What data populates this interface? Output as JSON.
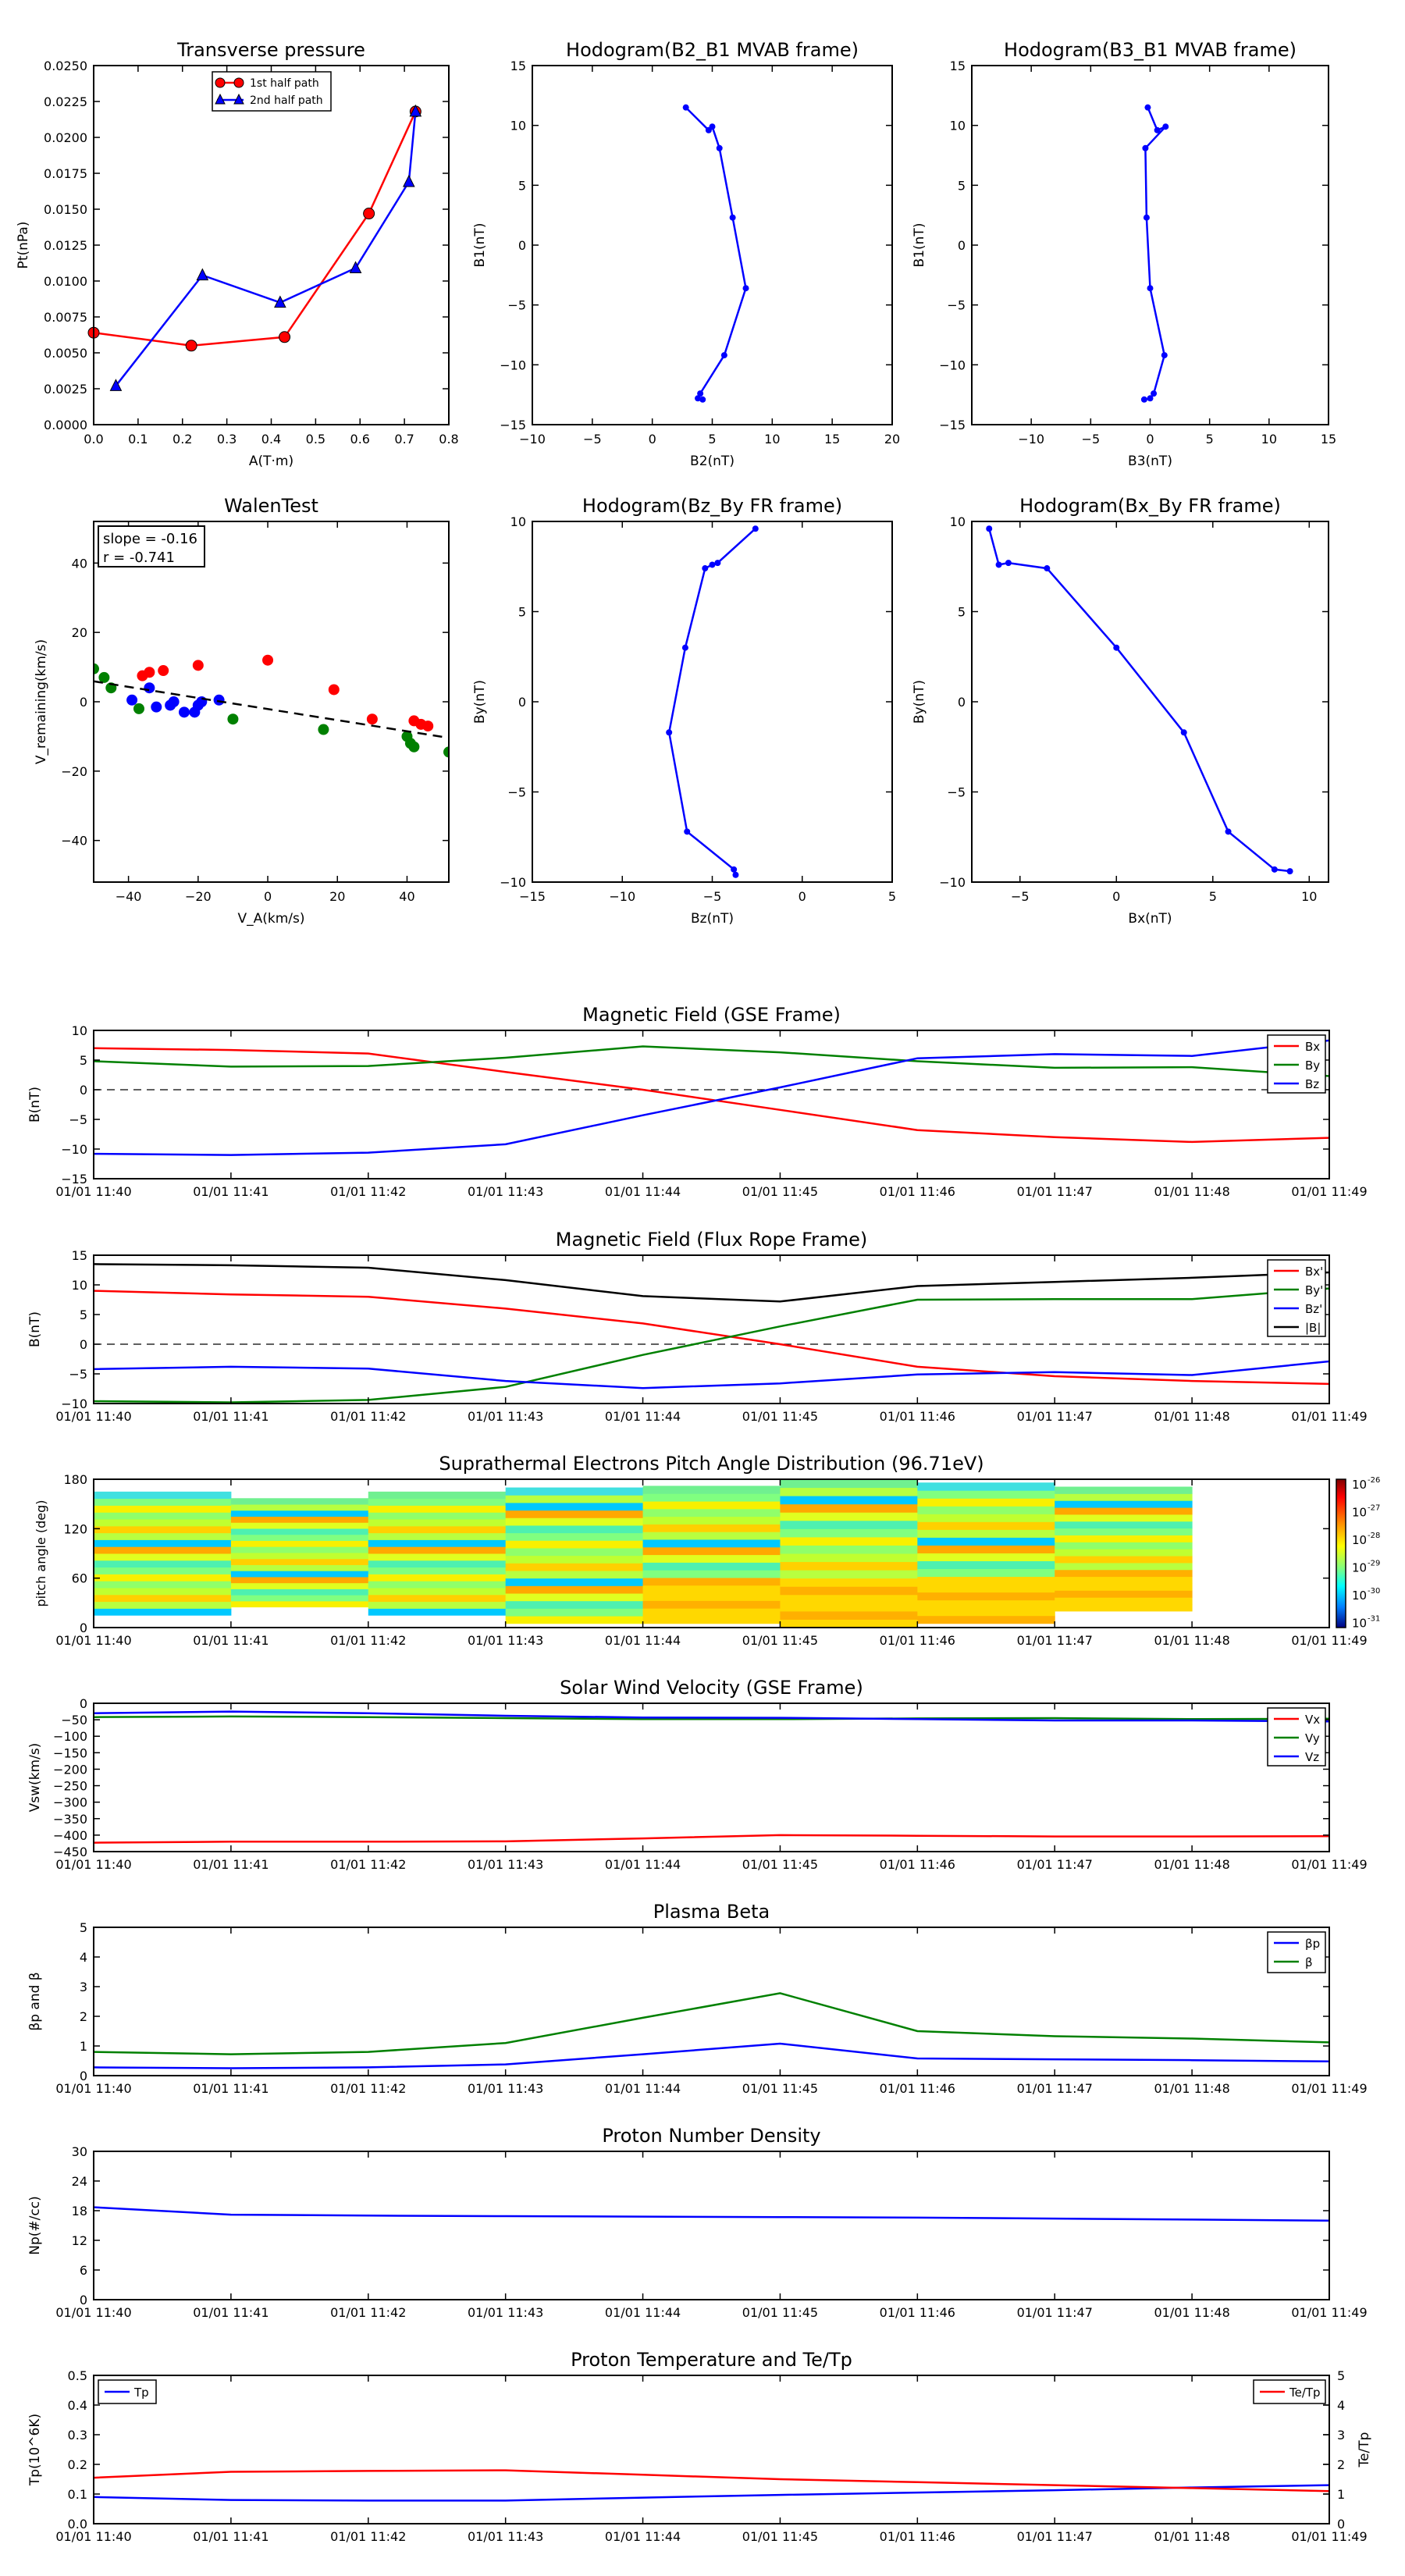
{
  "chart_data": [
    {
      "id": "tp",
      "type": "line",
      "title": "Transverse pressure",
      "xlabel": "A(T·m)",
      "ylabel": "Pt(nPa)",
      "xlim": [
        0.0,
        0.8
      ],
      "ylim": [
        0.0,
        0.025
      ],
      "xticks": [
        "0.0",
        "0.1",
        "0.2",
        "0.3",
        "0.4",
        "0.5",
        "0.6",
        "0.7",
        "0.8"
      ],
      "yticks": [
        "0.0000",
        "0.0025",
        "0.0050",
        "0.0075",
        "0.0100",
        "0.0125",
        "0.0150",
        "0.0175",
        "0.0200",
        "0.0225",
        "0.0250"
      ],
      "legend": "top-center",
      "series": [
        {
          "name": "1st half path",
          "color": "#ff0000",
          "marker": "circle",
          "x": [
            0.0,
            0.22,
            0.43,
            0.62,
            0.725
          ],
          "y": [
            0.0064,
            0.0055,
            0.0061,
            0.0147,
            0.0218
          ]
        },
        {
          "name": "2nd half path",
          "color": "#0000ff",
          "marker": "triangle",
          "x": [
            0.05,
            0.245,
            0.42,
            0.59,
            0.71,
            0.725
          ],
          "y": [
            0.0027,
            0.0104,
            0.0085,
            0.0109,
            0.0169,
            0.0218
          ]
        }
      ]
    },
    {
      "id": "h21",
      "type": "line",
      "title": "Hodogram(B2_B1 MVAB frame)",
      "xlabel": "B2(nT)",
      "ylabel": "B1(nT)",
      "xlim": [
        -10,
        20
      ],
      "ylim": [
        -15,
        15
      ],
      "xticks": [
        "−10",
        "−5",
        "0",
        "5",
        "10",
        "15",
        "20"
      ],
      "yticks": [
        "−15",
        "−10",
        "−5",
        "0",
        "5",
        "10",
        "15"
      ],
      "series": [
        {
          "color": "#0000ff",
          "marker": "dot",
          "x": [
            2.8,
            4.7,
            5.0,
            5.6,
            6.7,
            7.8,
            6.0,
            4.0,
            3.8,
            4.2
          ],
          "y": [
            11.5,
            9.6,
            9.9,
            8.1,
            2.3,
            -3.6,
            -9.2,
            -12.4,
            -12.8,
            -12.9
          ]
        }
      ]
    },
    {
      "id": "h31",
      "type": "line",
      "title": "Hodogram(B3_B1 MVAB frame)",
      "xlabel": "B3(nT)",
      "ylabel": "B1(nT)",
      "xlim": [
        -15,
        15
      ],
      "ylim": [
        -15,
        15
      ],
      "xticks": [
        "−10",
        "−5",
        "0",
        "5",
        "10",
        "15"
      ],
      "yticks": [
        "−15",
        "−10",
        "−5",
        "0",
        "5",
        "10",
        "15"
      ],
      "series": [
        {
          "color": "#0000ff",
          "marker": "dot",
          "x": [
            -0.2,
            0.6,
            1.3,
            -0.4,
            -0.3,
            0.0,
            1.2,
            0.3,
            0.0,
            -0.5
          ],
          "y": [
            11.5,
            9.6,
            9.9,
            8.1,
            2.3,
            -3.6,
            -9.2,
            -12.4,
            -12.8,
            -12.9
          ]
        }
      ]
    },
    {
      "id": "walen",
      "type": "scatter",
      "title": "WalenTest",
      "xlabel": "V_A(km/s)",
      "ylabel": "V_remaining(km/s)",
      "xlim": [
        -50,
        52
      ],
      "ylim": [
        -52,
        52
      ],
      "xticks": [
        "−40",
        "−20",
        "0",
        "20",
        "40"
      ],
      "yticks": [
        "−40",
        "−20",
        "0",
        "20",
        "40"
      ],
      "annotation": [
        "slope = -0.16",
        "r = -0.741"
      ],
      "fit": {
        "slope": -0.16,
        "intercept": -2.1
      },
      "series": [
        {
          "color": "#ff0000",
          "x": [
            -36,
            -34,
            -30,
            -20,
            0,
            19,
            30,
            42,
            44,
            46
          ],
          "y": [
            7.5,
            8.5,
            9,
            10.5,
            12,
            3.5,
            -5,
            -5.5,
            -6.5,
            -7
          ]
        },
        {
          "color": "#008000",
          "x": [
            -50,
            -47,
            -45,
            -37,
            -10,
            16,
            40,
            41,
            42,
            52
          ],
          "y": [
            9.5,
            7,
            4,
            -2,
            -5,
            -8,
            -10,
            -12,
            -13,
            -14.5
          ]
        },
        {
          "color": "#0000ff",
          "x": [
            -39,
            -34,
            -32,
            -28,
            -27,
            -24,
            -21,
            -20,
            -19,
            -14
          ],
          "y": [
            0.5,
            4,
            -1.5,
            -1,
            0,
            -3,
            -3,
            -1,
            0,
            0.5
          ]
        }
      ]
    },
    {
      "id": "hzy",
      "type": "line",
      "title": "Hodogram(Bz_By FR frame)",
      "xlabel": "Bz(nT)",
      "ylabel": "By(nT)",
      "xlim": [
        -15,
        5
      ],
      "ylim": [
        -10,
        10
      ],
      "xticks": [
        "−15",
        "−10",
        "−5",
        "0",
        "5"
      ],
      "yticks": [
        "−10",
        "−5",
        "0",
        "5",
        "10"
      ],
      "series": [
        {
          "color": "#0000ff",
          "marker": "dot",
          "x": [
            -2.6,
            -4.7,
            -5.0,
            -5.4,
            -6.5,
            -7.4,
            -6.4,
            -3.8,
            -3.7
          ],
          "y": [
            9.6,
            7.7,
            7.6,
            7.4,
            3.0,
            -1.7,
            -7.2,
            -9.3,
            -9.6
          ]
        }
      ]
    },
    {
      "id": "hxy",
      "type": "line",
      "title": "Hodogram(Bx_By FR frame)",
      "xlabel": "Bx(nT)",
      "ylabel": "By(nT)",
      "xlim": [
        -7.5,
        11
      ],
      "ylim": [
        -10,
        10
      ],
      "xticks": [
        "−5",
        "0",
        "5",
        "10"
      ],
      "yticks": [
        "−10",
        "−5",
        "0",
        "5",
        "10"
      ],
      "series": [
        {
          "color": "#0000ff",
          "marker": "dot",
          "x": [
            -6.6,
            -6.1,
            -5.6,
            -3.6,
            0.0,
            3.5,
            5.8,
            8.2,
            9.0
          ],
          "y": [
            9.6,
            7.6,
            7.7,
            7.4,
            3.0,
            -1.7,
            -7.2,
            -9.3,
            -9.4
          ]
        }
      ]
    },
    {
      "id": "mag_gse",
      "type": "line",
      "title": "Magnetic Field (GSE Frame)",
      "ylabel": "B(nT)",
      "x": [
        "01/01 11:40",
        "01/01 11:41",
        "01/01 11:42",
        "01/01 11:43",
        "01/01 11:44",
        "01/01 11:45",
        "01/01 11:46",
        "01/01 11:47",
        "01/01 11:48",
        "01/01 11:49"
      ],
      "ylim": [
        -15,
        10
      ],
      "yticks": [
        "−15",
        "−10",
        "−5",
        "0",
        "5",
        "10"
      ],
      "zero_line": true,
      "legend": "top-right",
      "series": [
        {
          "name": "Bx",
          "color": "#ff0000",
          "values": [
            7.0,
            6.7,
            6.1,
            3.0,
            0.0,
            -3.4,
            -6.8,
            -8.0,
            -8.8,
            -8.1
          ]
        },
        {
          "name": "By",
          "color": "#008000",
          "values": [
            4.8,
            3.9,
            4.0,
            5.4,
            7.3,
            6.3,
            4.8,
            3.7,
            3.8,
            2.3
          ]
        },
        {
          "name": "Bz",
          "color": "#0000ff",
          "values": [
            -10.8,
            -11.0,
            -10.6,
            -9.2,
            -4.3,
            0.4,
            5.3,
            6.0,
            5.7,
            8.3
          ]
        }
      ]
    },
    {
      "id": "mag_fr",
      "type": "line",
      "title": "Magnetic Field (Flux Rope Frame)",
      "ylabel": "B(nT)",
      "x": [
        "01/01 11:40",
        "01/01 11:41",
        "01/01 11:42",
        "01/01 11:43",
        "01/01 11:44",
        "01/01 11:45",
        "01/01 11:46",
        "01/01 11:47",
        "01/01 11:48",
        "01/01 11:49"
      ],
      "ylim": [
        -10,
        15
      ],
      "yticks": [
        "−10",
        "−5",
        "0",
        "5",
        "10",
        "15"
      ],
      "zero_line": true,
      "legend": "top-right",
      "series": [
        {
          "name": "Bx'",
          "color": "#ff0000",
          "values": [
            9.0,
            8.4,
            8.0,
            6.0,
            3.5,
            0.0,
            -3.8,
            -5.4,
            -6.2,
            -6.7
          ]
        },
        {
          "name": "By'",
          "color": "#008000",
          "values": [
            -9.6,
            -9.8,
            -9.4,
            -7.2,
            -1.8,
            3.0,
            7.5,
            7.6,
            7.6,
            9.4
          ]
        },
        {
          "name": "Bz'",
          "color": "#0000ff",
          "values": [
            -4.2,
            -3.8,
            -4.1,
            -6.2,
            -7.4,
            -6.6,
            -5.1,
            -4.7,
            -5.2,
            -2.9
          ]
        },
        {
          "name": "|B|",
          "color": "#000000",
          "values": [
            13.5,
            13.3,
            12.9,
            10.8,
            8.1,
            7.2,
            9.8,
            10.5,
            11.2,
            12.1
          ]
        }
      ]
    },
    {
      "id": "pad",
      "type": "heatmap",
      "title": "Suprathermal Electrons Pitch Angle Distribution (96.71eV)",
      "ylabel": "pitch angle (deg)",
      "x": [
        "01/01 11:40",
        "01/01 11:41",
        "01/01 11:42",
        "01/01 11:43",
        "01/01 11:44",
        "01/01 11:45",
        "01/01 11:46",
        "01/01 11:47",
        "01/01 11:48",
        "01/01 11:49"
      ],
      "ylim": [
        0,
        180
      ],
      "yticks": [
        "0",
        "60",
        "120",
        "180"
      ],
      "colorbar_ticks": [
        "10",
        "10",
        "10",
        "10",
        "10",
        "10"
      ],
      "colorbar_exponents": [
        "-26",
        "-27",
        "-28",
        "-29",
        "-30",
        "-31"
      ],
      "columns": [
        {
          "start": 0,
          "end": 1,
          "top": 165,
          "bottom": 15
        },
        {
          "start": 1,
          "end": 2,
          "top": 157,
          "bottom": 25
        },
        {
          "start": 2,
          "end": 3,
          "top": 165,
          "bottom": 15
        },
        {
          "start": 3,
          "end": 4,
          "top": 170,
          "bottom": 5
        },
        {
          "start": 4,
          "end": 5,
          "top": 172,
          "bottom": 5
        },
        {
          "start": 5,
          "end": 6,
          "top": 180,
          "bottom": 0
        },
        {
          "start": 6,
          "end": 7,
          "top": 176,
          "bottom": 5
        },
        {
          "start": 7,
          "end": 8,
          "top": 171,
          "bottom": 20
        }
      ]
    },
    {
      "id": "vsw",
      "type": "line",
      "title": "Solar Wind Velocity (GSE Frame)",
      "ylabel": "Vsw(km/s)",
      "x": [
        "01/01 11:40",
        "01/01 11:41",
        "01/01 11:42",
        "01/01 11:43",
        "01/01 11:44",
        "01/01 11:45",
        "01/01 11:46",
        "01/01 11:47",
        "01/01 11:48",
        "01/01 11:49"
      ],
      "ylim": [
        -450,
        0
      ],
      "yticks": [
        "0",
        "−50",
        "−100",
        "−150",
        "−200",
        "−250",
        "−300",
        "−350",
        "−400",
        "−450"
      ],
      "legend": "top-right",
      "series": [
        {
          "name": "Vx",
          "color": "#ff0000",
          "values": [
            -423,
            -420,
            -420,
            -419,
            -410,
            -400,
            -402,
            -404,
            -404,
            -403
          ]
        },
        {
          "name": "Vy",
          "color": "#008000",
          "values": [
            -42,
            -40,
            -42,
            -45,
            -48,
            -48,
            -46,
            -45,
            -48,
            -47
          ]
        },
        {
          "name": "Vz",
          "color": "#0000ff",
          "values": [
            -30,
            -25,
            -30,
            -38,
            -43,
            -44,
            -48,
            -52,
            -52,
            -55
          ]
        }
      ]
    },
    {
      "id": "beta",
      "type": "line",
      "title": "Plasma Beta",
      "ylabel": "βp and β",
      "x": [
        "01/01 11:40",
        "01/01 11:41",
        "01/01 11:42",
        "01/01 11:43",
        "01/01 11:44",
        "01/01 11:45",
        "01/01 11:46",
        "01/01 11:47",
        "01/01 11:48",
        "01/01 11:49"
      ],
      "ylim": [
        0,
        5
      ],
      "yticks": [
        "0",
        "1",
        "2",
        "3",
        "4",
        "5"
      ],
      "legend": "top-right",
      "series": [
        {
          "name": "βp",
          "color": "#0000ff",
          "values": [
            0.28,
            0.25,
            0.28,
            0.38,
            0.72,
            1.08,
            0.58,
            0.55,
            0.52,
            0.48
          ]
        },
        {
          "name": "β",
          "color": "#008000",
          "values": [
            0.8,
            0.72,
            0.8,
            1.1,
            1.95,
            2.78,
            1.5,
            1.33,
            1.25,
            1.12
          ]
        }
      ]
    },
    {
      "id": "np",
      "type": "line",
      "title": "Proton Number Density",
      "ylabel": "Np(#/cc)",
      "x": [
        "01/01 11:40",
        "01/01 11:41",
        "01/01 11:42",
        "01/01 11:43",
        "01/01 11:44",
        "01/01 11:45",
        "01/01 11:46",
        "01/01 11:47",
        "01/01 11:48",
        "01/01 11:49"
      ],
      "ylim": [
        0,
        30
      ],
      "yticks": [
        "0",
        "6",
        "12",
        "18",
        "24",
        "30"
      ],
      "series": [
        {
          "color": "#0000ff",
          "values": [
            18.7,
            17.2,
            17.0,
            16.9,
            16.8,
            16.7,
            16.6,
            16.4,
            16.2,
            16.0
          ]
        }
      ]
    },
    {
      "id": "tp_ratio",
      "type": "line",
      "title": "Proton Temperature and Te/Tp",
      "ylabel": "Tp(10^6K)",
      "ylabel_right": "Te/Tp",
      "x": [
        "01/01 11:40",
        "01/01 11:41",
        "01/01 11:42",
        "01/01 11:43",
        "01/01 11:44",
        "01/01 11:45",
        "01/01 11:46",
        "01/01 11:47",
        "01/01 11:48",
        "01/01 11:49"
      ],
      "ylim": [
        0,
        0.5
      ],
      "ylim_right": [
        0,
        5
      ],
      "yticks": [
        "0.0",
        "0.1",
        "0.2",
        "0.3",
        "0.4",
        "0.5"
      ],
      "yticks_right": [
        "0",
        "1",
        "2",
        "3",
        "4",
        "5"
      ],
      "legend": [
        "top-left",
        "top-right"
      ],
      "series": [
        {
          "name": "Tp",
          "color": "#0000ff",
          "axis": "left",
          "values": [
            0.09,
            0.08,
            0.078,
            0.078,
            0.088,
            0.097,
            0.105,
            0.113,
            0.122,
            0.13
          ]
        },
        {
          "name": "Te/Tp",
          "color": "#ff0000",
          "axis": "right",
          "values": [
            1.55,
            1.75,
            1.78,
            1.8,
            1.65,
            1.5,
            1.4,
            1.3,
            1.2,
            1.1
          ]
        }
      ]
    }
  ]
}
